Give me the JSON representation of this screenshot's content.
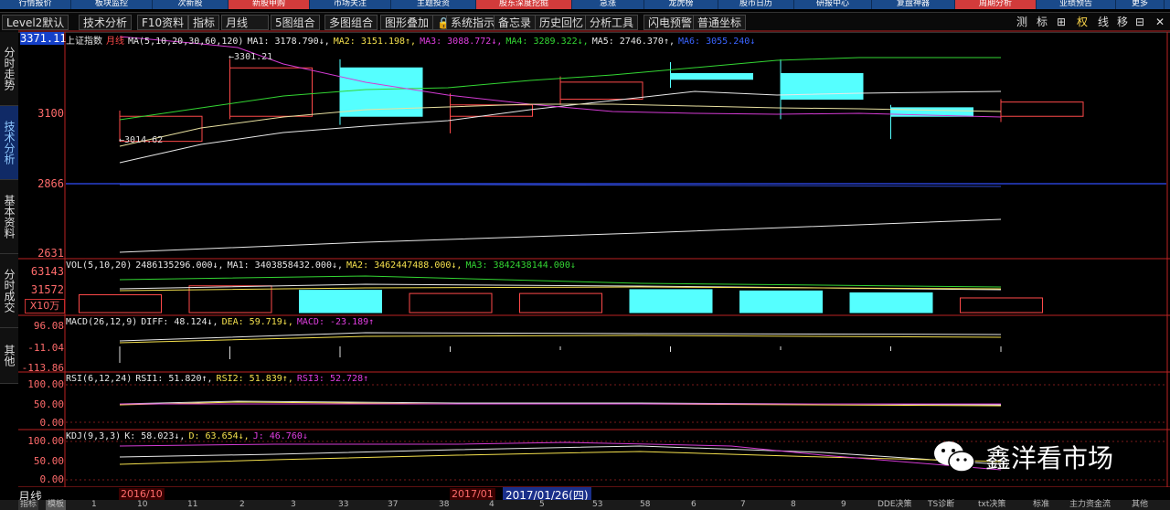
{
  "topnav": {
    "tabs": [
      {
        "label": "行情报价",
        "hot": false
      },
      {
        "label": "板块监控",
        "hot": false
      },
      {
        "label": "次新股",
        "hot": false
      },
      {
        "label": "新股申购",
        "hot": true
      },
      {
        "label": "市场关注",
        "hot": false
      },
      {
        "label": "主题投资",
        "hot": false
      },
      {
        "label": "股东深度挖掘",
        "hot": true
      },
      {
        "label": "急涨",
        "hot": false
      },
      {
        "label": "龙虎榜",
        "hot": false
      },
      {
        "label": "股市日历",
        "hot": false
      },
      {
        "label": "研报中心",
        "hot": false
      },
      {
        "label": "复盘神器",
        "hot": false
      },
      {
        "label": "周期分析",
        "hot": true
      },
      {
        "label": "业绩预告",
        "hot": false
      },
      {
        "label": "更多",
        "hot": false
      }
    ]
  },
  "toolbar": {
    "level2": "Level2默认",
    "tech": "技术分析",
    "f10": "F10资料",
    "indicator": "指标",
    "period": "月线",
    "fivechart": "5图组合",
    "multichart": "多图组合",
    "overlay": "图形叠加",
    "sysindicator": "系统指示",
    "memo": "备忘录",
    "history": "历史回忆",
    "analysis": "分析工具",
    "alert": "闪电预警",
    "coord": "普通坐标",
    "right_tools": [
      "测",
      "标",
      "⊞",
      "权",
      "线",
      "移",
      "⊟",
      "✕"
    ]
  },
  "left_tabs": [
    {
      "label": "分时走势",
      "active": false
    },
    {
      "label": "技术分析",
      "active": true
    },
    {
      "label": "基本资料",
      "active": false
    },
    {
      "label": "分时成交",
      "active": false
    },
    {
      "label": "其他",
      "active": false
    }
  ],
  "price_axis": {
    "current": "3371.11",
    "ticks": [
      {
        "label": "3100"
      },
      {
        "label": "2866"
      },
      {
        "label": "2631"
      }
    ]
  },
  "vol_axis": {
    "ticks": [
      "63143",
      "31572"
    ],
    "unit": "X10万"
  },
  "macd_axis": {
    "ticks": [
      "96.08",
      "-11.04",
      "-113.86"
    ]
  },
  "rsi_axis": {
    "ticks": [
      "100.00",
      "50.00",
      "0.00"
    ]
  },
  "kdj_axis": {
    "ticks": [
      "100.00",
      "50.00",
      "0.00"
    ]
  },
  "main_header": {
    "name": "上证指数",
    "period": "月线",
    "ma": "MA(5,10,20,30,60,120)",
    "ma1": "MA1: 3178.790↓,",
    "ma2": "MA2: 3151.198↑,",
    "ma3": "MA3: 3088.772↓,",
    "ma4": "MA4: 3289.322↓,",
    "ma5": "MA5: 2746.370↑,",
    "ma6": "MA6: 3055.240↓"
  },
  "annotations": {
    "high": "3301.21",
    "low": "3014.62"
  },
  "vol_header": {
    "name": "VOL(5,10,20)",
    "v": "2486135296.000↓,",
    "ma1": "MA1: 3403858432.000↓,",
    "ma2": "MA2: 3462447488.000↓,",
    "ma3": "MA3: 3842438144.000↓"
  },
  "macd_header": {
    "name": "MACD(26,12,9)",
    "diff": "DIFF: 48.124↓,",
    "dea": "DEA: 59.719↓,",
    "macd": "MACD: -23.189↑"
  },
  "rsi_header": {
    "name": "RSI(6,12,24)",
    "rsi1": "RSI1: 51.820↑,",
    "rsi2": "RSI2: 51.839↑,",
    "rsi3": "RSI3: 52.728↑"
  },
  "kdj_header": {
    "name": "KDJ(9,3,3)",
    "k": "K: 58.023↓,",
    "d": "D: 63.654↓,",
    "j": "J: 46.760↓"
  },
  "bottom": {
    "period": "月线",
    "date1": "2016/10",
    "date2": "2017/01",
    "date3": "2017/01/26(四)",
    "nums": [
      "指标",
      "模板",
      "1",
      "10",
      "11",
      "2",
      "3",
      "33",
      "37",
      "38",
      "4",
      "5",
      "53",
      "58",
      "6",
      "7",
      "8",
      "9",
      "DDE决策",
      "TS诊断",
      "txt决策",
      "标准",
      "主力资金流",
      "其他"
    ]
  },
  "watermark": {
    "text": "鑫洋看市场"
  },
  "chart_data": {
    "type": "candlestick",
    "title": "上证指数 月线",
    "candles": [
      {
        "open": 3012,
        "close": 3100,
        "high": 3120,
        "low": 3014.62,
        "dir": "up"
      },
      {
        "open": 3100,
        "close": 3270,
        "high": 3301.21,
        "low": 3090,
        "dir": "up"
      },
      {
        "open": 3270,
        "close": 3100,
        "high": 3300,
        "low": 3070,
        "dir": "down"
      },
      {
        "open": 3100,
        "close": 3140,
        "high": 3180,
        "low": 3040,
        "dir": "up"
      },
      {
        "open": 3160,
        "close": 3220,
        "high": 3240,
        "low": 3140,
        "dir": "up"
      },
      {
        "open": 3250,
        "close": 3230,
        "high": 3290,
        "low": 3200,
        "dir": "down"
      },
      {
        "open": 3250,
        "close": 3160,
        "high": 3300,
        "low": 3090,
        "dir": "down"
      },
      {
        "open": 3130,
        "close": 3100,
        "high": 3140,
        "low": 3020,
        "dir": "down"
      },
      {
        "open": 3100,
        "close": 3150,
        "high": 3160,
        "low": 3080,
        "dir": "up"
      }
    ],
    "volume": [
      28000,
      42000,
      35000,
      30000,
      30000,
      36000,
      34000,
      31000,
      23000
    ],
    "ylim": [
      2600,
      3380
    ],
    "vol_ylim": [
      0,
      63143
    ]
  }
}
